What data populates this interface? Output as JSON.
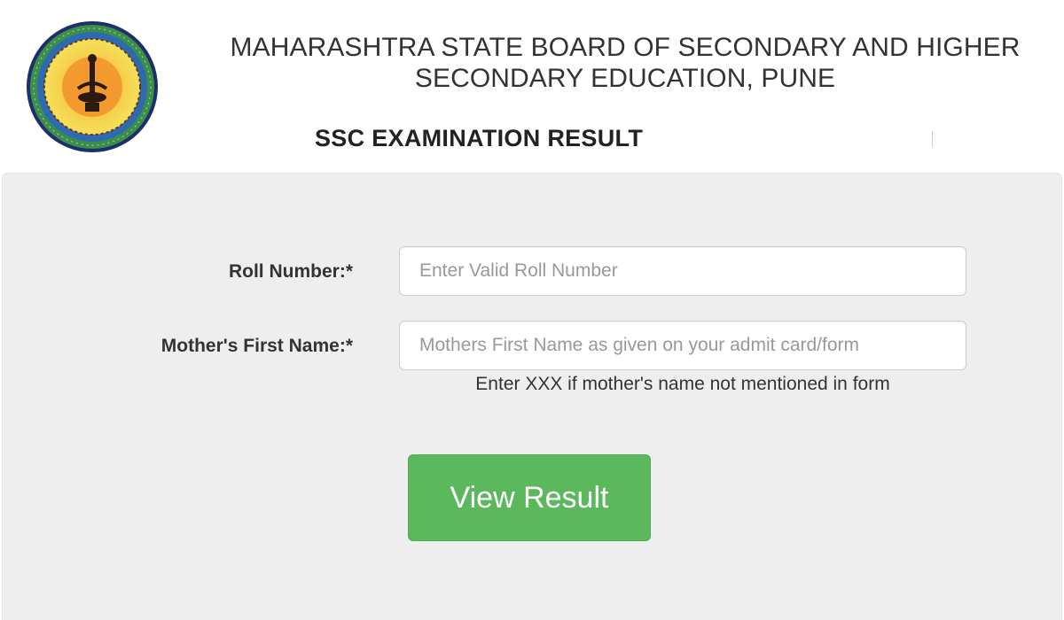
{
  "header": {
    "logo_icon": "board-seal-logo",
    "board_name": "MAHARASHTRA STATE BOARD OF SECONDARY AND HIGHER SECONDARY EDUCATION, PUNE",
    "exam_title": "SSC EXAMINATION RESULT"
  },
  "form": {
    "roll_number": {
      "label": "Roll Number:*",
      "placeholder": "Enter Valid Roll Number",
      "value": ""
    },
    "mother_name": {
      "label": "Mother's First Name:*",
      "placeholder": "Mothers First Name as given on your admit card/form",
      "value": "",
      "hint": "Enter XXX if mother's name not mentioned in form"
    },
    "submit_label": "View Result"
  },
  "colors": {
    "panel_bg": "#eeeeee",
    "button_bg": "#5cb85c",
    "button_text": "#ffffff",
    "text": "#333333"
  }
}
